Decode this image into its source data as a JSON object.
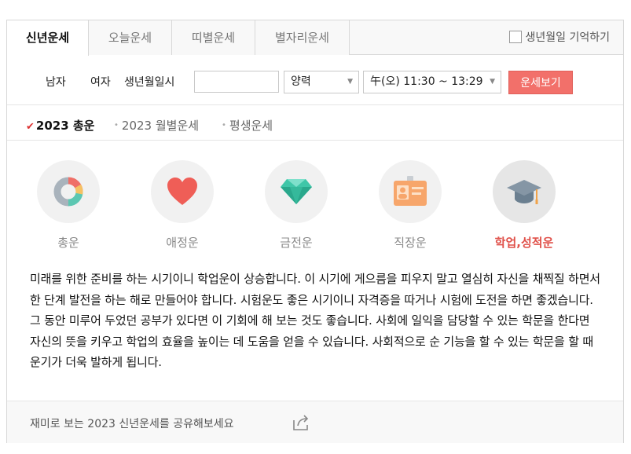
{
  "tabs": [
    {
      "label": "신년운세",
      "active": true
    },
    {
      "label": "오늘운세",
      "active": false
    },
    {
      "label": "띠별운세",
      "active": false
    },
    {
      "label": "별자리운세",
      "active": false
    }
  ],
  "remember_label": "생년월일 기억하기",
  "form": {
    "male_label": "남자",
    "female_label": "여자",
    "birth_label": "생년월일시",
    "birth_value": "",
    "calendar_select": "양력",
    "time_select": "午(오) 11:30 ~ 13:29",
    "submit_label": "운세보기"
  },
  "subtabs": [
    {
      "label": "2023 총운",
      "active": true
    },
    {
      "label": "2023 월별운세",
      "active": false
    },
    {
      "label": "평생운세",
      "active": false
    }
  ],
  "categories": [
    {
      "label": "총운",
      "icon": "donut-chart-icon",
      "active": false
    },
    {
      "label": "애정운",
      "icon": "heart-icon",
      "active": false
    },
    {
      "label": "금전운",
      "icon": "diamond-icon",
      "active": false
    },
    {
      "label": "직장운",
      "icon": "id-badge-icon",
      "active": false
    },
    {
      "label": "학업,성적운",
      "icon": "graduation-cap-icon",
      "active": true
    }
  ],
  "description": "미래를 위한 준비를 하는 시기이니 학업운이 상승합니다. 이 시기에 게으름을 피우지 말고 열심히 자신을 채찍질 하면서 한 단계 발전을 하는 해로 만들어야 합니다. 시험운도 좋은 시기이니 자격증을 따거나 시험에 도전을 하면 좋겠습니다. 그 동안 미루어 두었던 공부가 있다면 이 기회에 해 보는 것도 좋습니다. 사회에 일익을 담당할 수 있는 학문을 한다면 자신의 뜻을 키우고 학업의 효율을 높이는 데 도움을 얻을 수 있습니다. 사회적으로 순 기능을 할 수 있는 학문을 할 때 운기가 더욱 발하게 됩니다.",
  "share_text": "재미로 보는 2023 신년운세를 공유해보세요",
  "colors": {
    "accent": "#f2706a",
    "active_category": "#e0514a",
    "check": "#dd3333"
  }
}
